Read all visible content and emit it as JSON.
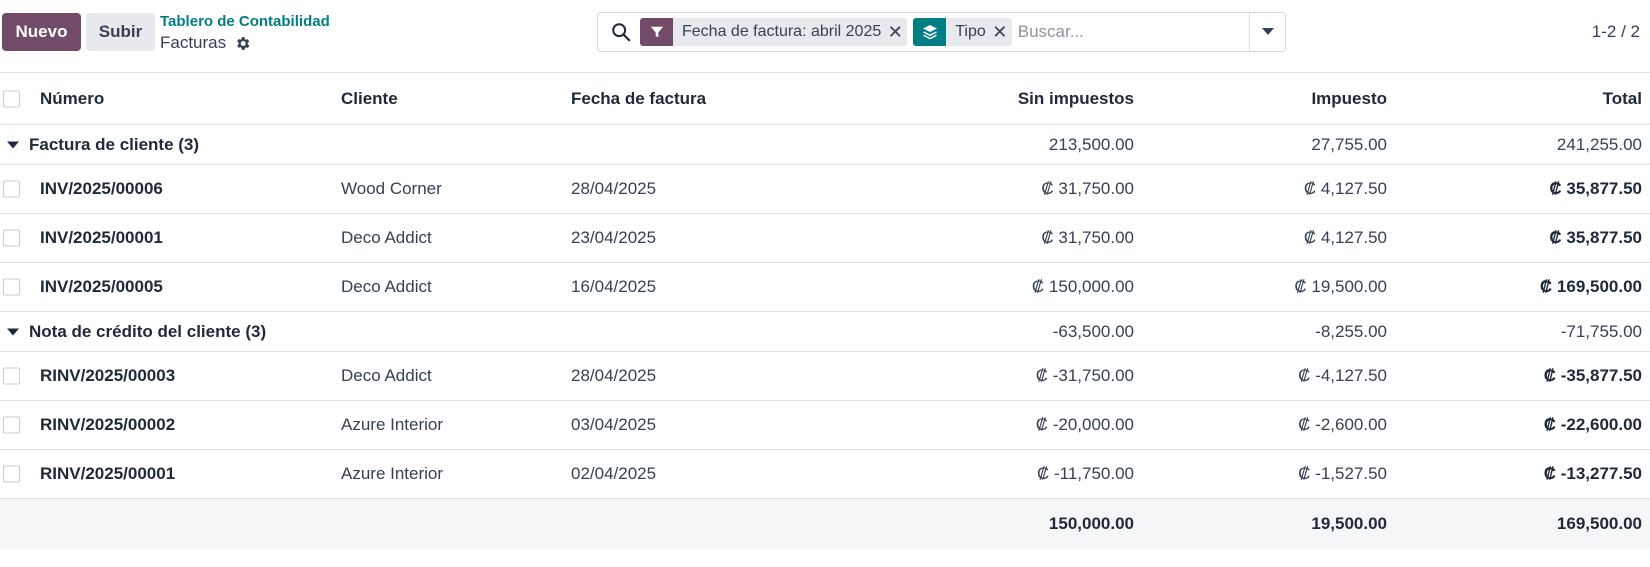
{
  "header": {
    "new_label": "Nuevo",
    "upload_label": "Subir",
    "breadcrumb_parent": "Tablero de Contabilidad",
    "breadcrumb_current": "Facturas"
  },
  "search": {
    "facet_filter": "Fecha de factura: abril 2025",
    "facet_group": "Tipo",
    "placeholder": "Buscar..."
  },
  "pager": "1-2 / 2",
  "columns": {
    "numero": "Número",
    "cliente": "Cliente",
    "fecha": "Fecha de factura",
    "sin_impuestos": "Sin impuestos",
    "impuesto": "Impuesto",
    "total": "Total"
  },
  "groups": [
    {
      "label": "Factura de cliente (3)",
      "sin": "213,500.00",
      "imp": "27,755.00",
      "total": "241,255.00",
      "rows": [
        {
          "numero": "INV/2025/00006",
          "cliente": "Wood Corner",
          "fecha": "28/04/2025",
          "sin": "₡ 31,750.00",
          "imp": "₡ 4,127.50",
          "total": "₡ 35,877.50"
        },
        {
          "numero": "INV/2025/00001",
          "cliente": "Deco Addict",
          "fecha": "23/04/2025",
          "sin": "₡ 31,750.00",
          "imp": "₡ 4,127.50",
          "total": "₡ 35,877.50"
        },
        {
          "numero": "INV/2025/00005",
          "cliente": "Deco Addict",
          "fecha": "16/04/2025",
          "sin": "₡ 150,000.00",
          "imp": "₡ 19,500.00",
          "total": "₡ 169,500.00"
        }
      ]
    },
    {
      "label": "Nota de crédito del cliente (3)",
      "sin": "-63,500.00",
      "imp": "-8,255.00",
      "total": "-71,755.00",
      "rows": [
        {
          "numero": "RINV/2025/00003",
          "cliente": "Deco Addict",
          "fecha": "28/04/2025",
          "sin": "₡ -31,750.00",
          "imp": "₡ -4,127.50",
          "total": "₡ -35,877.50"
        },
        {
          "numero": "RINV/2025/00002",
          "cliente": "Azure Interior",
          "fecha": "03/04/2025",
          "sin": "₡ -20,000.00",
          "imp": "₡ -2,600.00",
          "total": "₡ -22,600.00"
        },
        {
          "numero": "RINV/2025/00001",
          "cliente": "Azure Interior",
          "fecha": "02/04/2025",
          "sin": "₡ -11,750.00",
          "imp": "₡ -1,527.50",
          "total": "₡ -13,277.50"
        }
      ]
    }
  ],
  "footer": {
    "sin": "150,000.00",
    "imp": "19,500.00",
    "total": "169,500.00"
  },
  "colors": {
    "primary": "#714b67",
    "accent": "#017e84"
  }
}
